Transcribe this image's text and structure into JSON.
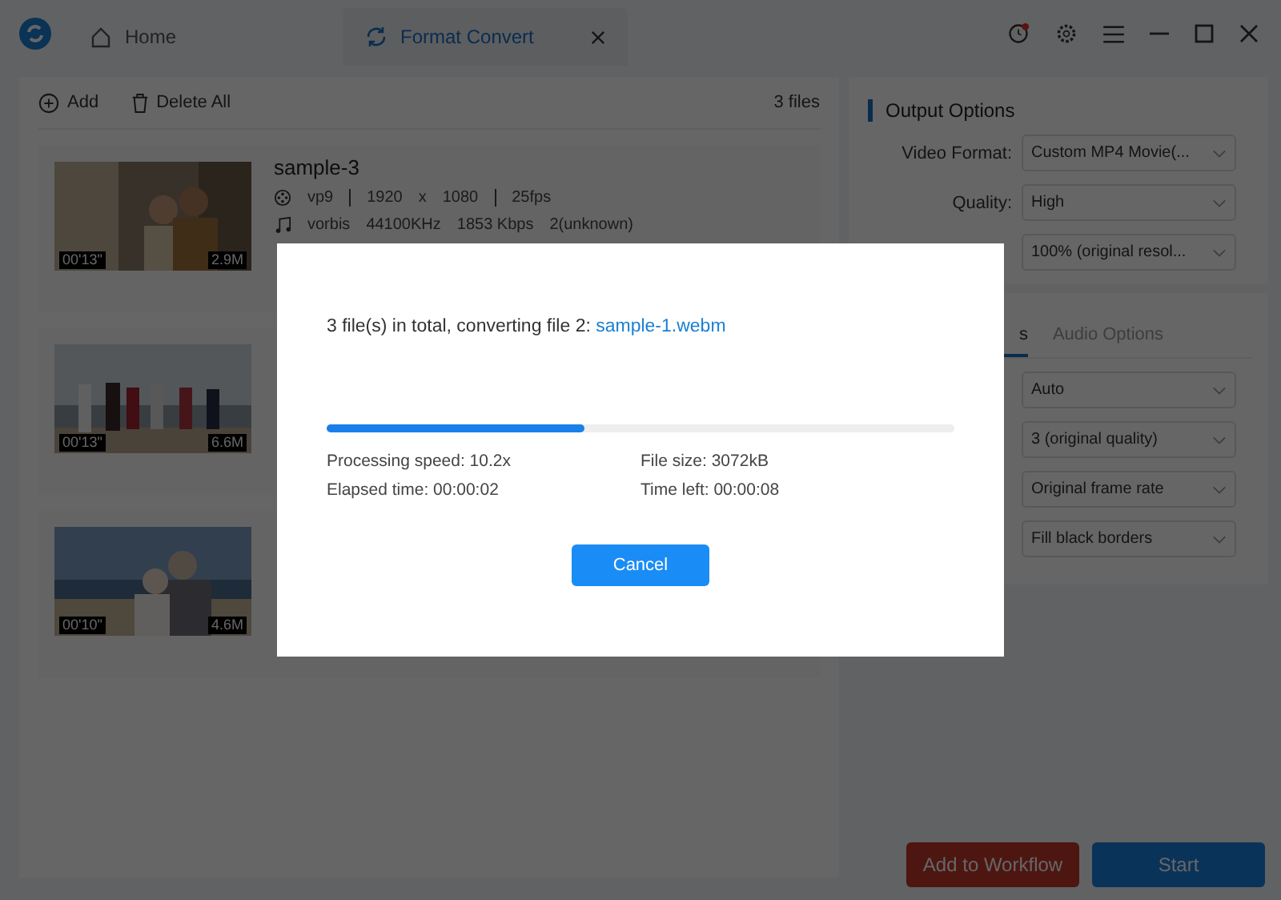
{
  "title_bar": {
    "tabs": [
      {
        "label": "Home",
        "kind": "home",
        "selected": false
      },
      {
        "label": "Format Convert",
        "kind": "convert",
        "selected": true
      }
    ]
  },
  "toolbar": {
    "add": "Add",
    "delete_all": "Delete All",
    "count": "3 files"
  },
  "files": [
    {
      "title": "sample-3",
      "video": [
        "vp9",
        "1920",
        "x",
        "1080",
        "25fps"
      ],
      "audio": [
        "vorbis",
        "44100KHz",
        "1853 Kbps",
        "2(unknown)"
      ],
      "duration": "00'13\"",
      "size": "2.9M"
    },
    {
      "duration": "00'13\"",
      "size": "6.6M"
    },
    {
      "duration": "00'10\"",
      "size": "4.6M"
    }
  ],
  "output_options": {
    "title": "Output Options",
    "rows": [
      {
        "label": "Video Format:",
        "value": "Custom MP4 Movie(..."
      },
      {
        "label": "Quality:",
        "value": "High"
      },
      {
        "value": "100% (original resol..."
      }
    ]
  },
  "option_tabs": [
    {
      "label": "s",
      "selected": true
    },
    {
      "label": "Audio Options",
      "selected": false
    }
  ],
  "video_rows": [
    {
      "value": "Auto"
    },
    {
      "value": "3 (original quality)"
    },
    {
      "value": "Original frame rate"
    },
    {
      "value": "Fill black borders"
    }
  ],
  "buttons": {
    "workflow": "Add to Workflow",
    "start": "Start"
  },
  "dialog": {
    "message": "3 file(s) in total, converting file 2: ",
    "file": "sample-1.webm",
    "level": 0.41,
    "stats": [
      "Processing speed: 10.2x",
      "File size: 3072kB",
      "Elapsed time: 00:00:02",
      "Time left: 00:00:08"
    ],
    "cancel": "Cancel"
  }
}
